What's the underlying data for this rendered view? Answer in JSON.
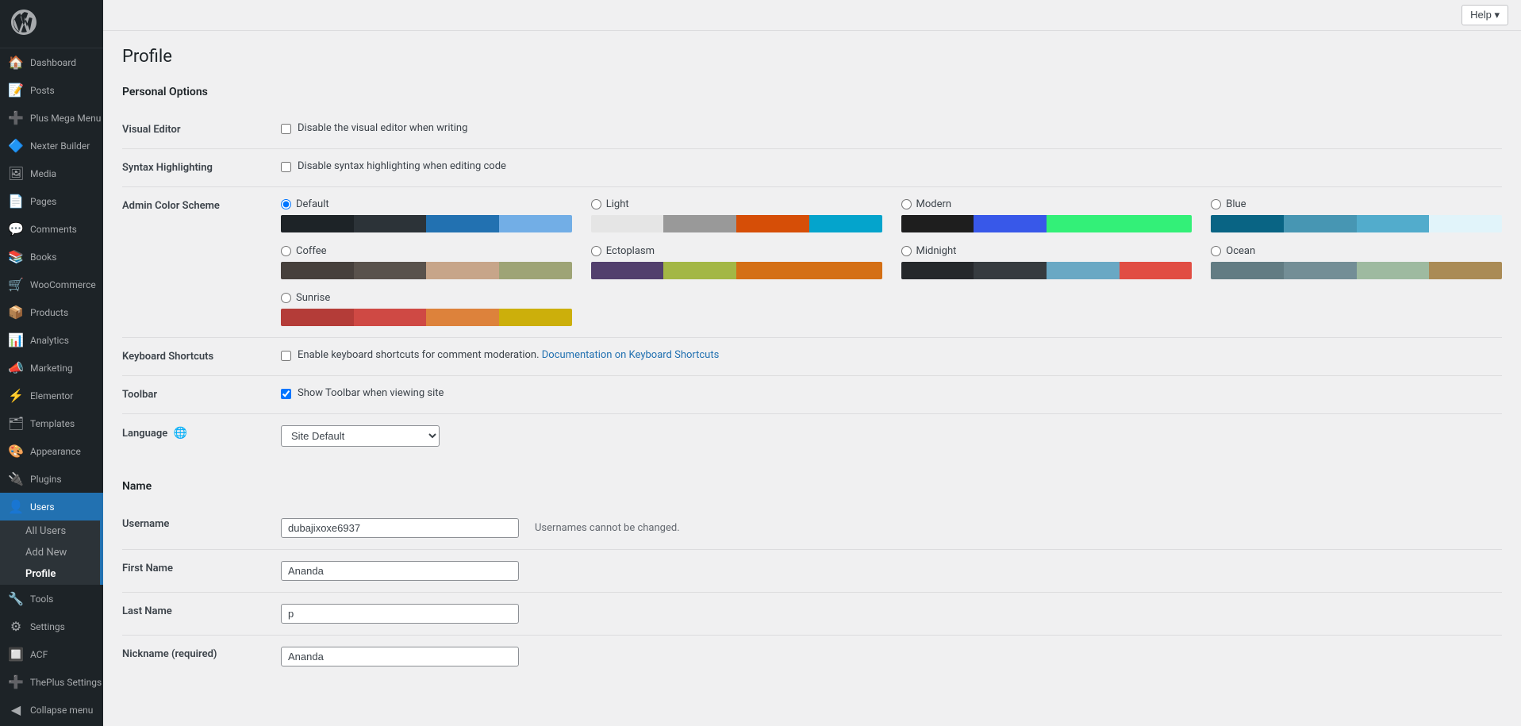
{
  "sidebar": {
    "items": [
      {
        "id": "dashboard",
        "label": "Dashboard",
        "icon": "🏠"
      },
      {
        "id": "posts",
        "label": "Posts",
        "icon": "📝"
      },
      {
        "id": "plus-mega-menu",
        "label": "Plus Mega Menu",
        "icon": "➕"
      },
      {
        "id": "nexter-builder",
        "label": "Nexter Builder",
        "icon": "🔷"
      },
      {
        "id": "media",
        "label": "Media",
        "icon": "🖼"
      },
      {
        "id": "pages",
        "label": "Pages",
        "icon": "📄"
      },
      {
        "id": "comments",
        "label": "Comments",
        "icon": "💬"
      },
      {
        "id": "books",
        "label": "Books",
        "icon": "📚"
      },
      {
        "id": "woocommerce",
        "label": "WooCommerce",
        "icon": "🛒"
      },
      {
        "id": "products",
        "label": "Products",
        "icon": "📦"
      },
      {
        "id": "analytics",
        "label": "Analytics",
        "icon": "📊"
      },
      {
        "id": "marketing",
        "label": "Marketing",
        "icon": "📣"
      },
      {
        "id": "elementor",
        "label": "Elementor",
        "icon": "⚡"
      },
      {
        "id": "templates",
        "label": "Templates",
        "icon": "🗂"
      },
      {
        "id": "appearance",
        "label": "Appearance",
        "icon": "🎨"
      },
      {
        "id": "plugins",
        "label": "Plugins",
        "icon": "🔌"
      },
      {
        "id": "users",
        "label": "Users",
        "icon": "👤",
        "active": true
      },
      {
        "id": "tools",
        "label": "Tools",
        "icon": "🔧"
      },
      {
        "id": "settings",
        "label": "Settings",
        "icon": "⚙"
      },
      {
        "id": "acf",
        "label": "ACF",
        "icon": "🔲"
      },
      {
        "id": "theplus-settings",
        "label": "ThePlus Settings",
        "icon": "➕"
      },
      {
        "id": "collapse",
        "label": "Collapse menu",
        "icon": "◀"
      }
    ],
    "users_submenu": [
      {
        "id": "all-users",
        "label": "All Users"
      },
      {
        "id": "add-new",
        "label": "Add New"
      },
      {
        "id": "profile",
        "label": "Profile",
        "active": true
      }
    ]
  },
  "topbar": {
    "help_label": "Help ▾"
  },
  "page": {
    "title": "Profile",
    "sections": {
      "personal_options": {
        "title": "Personal Options",
        "visual_editor": {
          "label": "Visual Editor",
          "checkbox_label": "Disable the visual editor when writing",
          "checked": false
        },
        "syntax_highlighting": {
          "label": "Syntax Highlighting",
          "checkbox_label": "Disable syntax highlighting when editing code",
          "checked": false
        },
        "admin_color_scheme": {
          "label": "Admin Color Scheme",
          "schemes": [
            {
              "id": "default",
              "label": "Default",
              "selected": true,
              "colors": [
                "#1d2327",
                "#2c3338",
                "#2271b1",
                "#72aee6"
              ]
            },
            {
              "id": "light",
              "label": "Light",
              "selected": false,
              "colors": [
                "#e5e5e5",
                "#999",
                "#d64e07",
                "#04a4cc"
              ]
            },
            {
              "id": "modern",
              "label": "Modern",
              "selected": false,
              "colors": [
                "#1e1e1e",
                "#3858e9",
                "#33f078",
                "#33f078"
              ]
            },
            {
              "id": "blue",
              "label": "Blue",
              "selected": false,
              "colors": [
                "#096484",
                "#4796b3",
                "#52accc",
                "#e1f4fa"
              ]
            },
            {
              "id": "coffee",
              "label": "Coffee",
              "selected": false,
              "colors": [
                "#46403c",
                "#59524c",
                "#c7a589",
                "#9ea476"
              ]
            },
            {
              "id": "ectoplasm",
              "label": "Ectoplasm",
              "selected": false,
              "colors": [
                "#523f6d",
                "#a3b745",
                "#d46f15",
                "#d46f15"
              ]
            },
            {
              "id": "midnight",
              "label": "Midnight",
              "selected": false,
              "colors": [
                "#25282b",
                "#363b3f",
                "#69a8c4",
                "#e14d43"
              ]
            },
            {
              "id": "ocean",
              "label": "Ocean",
              "selected": false,
              "colors": [
                "#627c83",
                "#738e96",
                "#9ebaa0",
                "#aa8b56"
              ]
            },
            {
              "id": "sunrise",
              "label": "Sunrise",
              "selected": false,
              "colors": [
                "#b43c38",
                "#cf4944",
                "#dd823b",
                "#ccaf0b"
              ]
            }
          ]
        },
        "keyboard_shortcuts": {
          "label": "Keyboard Shortcuts",
          "checkbox_label": "Enable keyboard shortcuts for comment moderation.",
          "link_label": "Documentation on Keyboard Shortcuts",
          "checked": false
        },
        "toolbar": {
          "label": "Toolbar",
          "checkbox_label": "Show Toolbar when viewing site",
          "checked": true
        },
        "language": {
          "label": "Language",
          "icon": "🌐",
          "options": [
            "Site Default"
          ],
          "selected": "Site Default"
        }
      },
      "name": {
        "title": "Name",
        "username": {
          "label": "Username",
          "value": "dubajixoxe6937",
          "note": "Usernames cannot be changed."
        },
        "first_name": {
          "label": "First Name",
          "value": "Ananda"
        },
        "last_name": {
          "label": "Last Name",
          "value": "p"
        },
        "nickname": {
          "label": "Nickname (required)",
          "value": "Ananda"
        }
      }
    }
  }
}
